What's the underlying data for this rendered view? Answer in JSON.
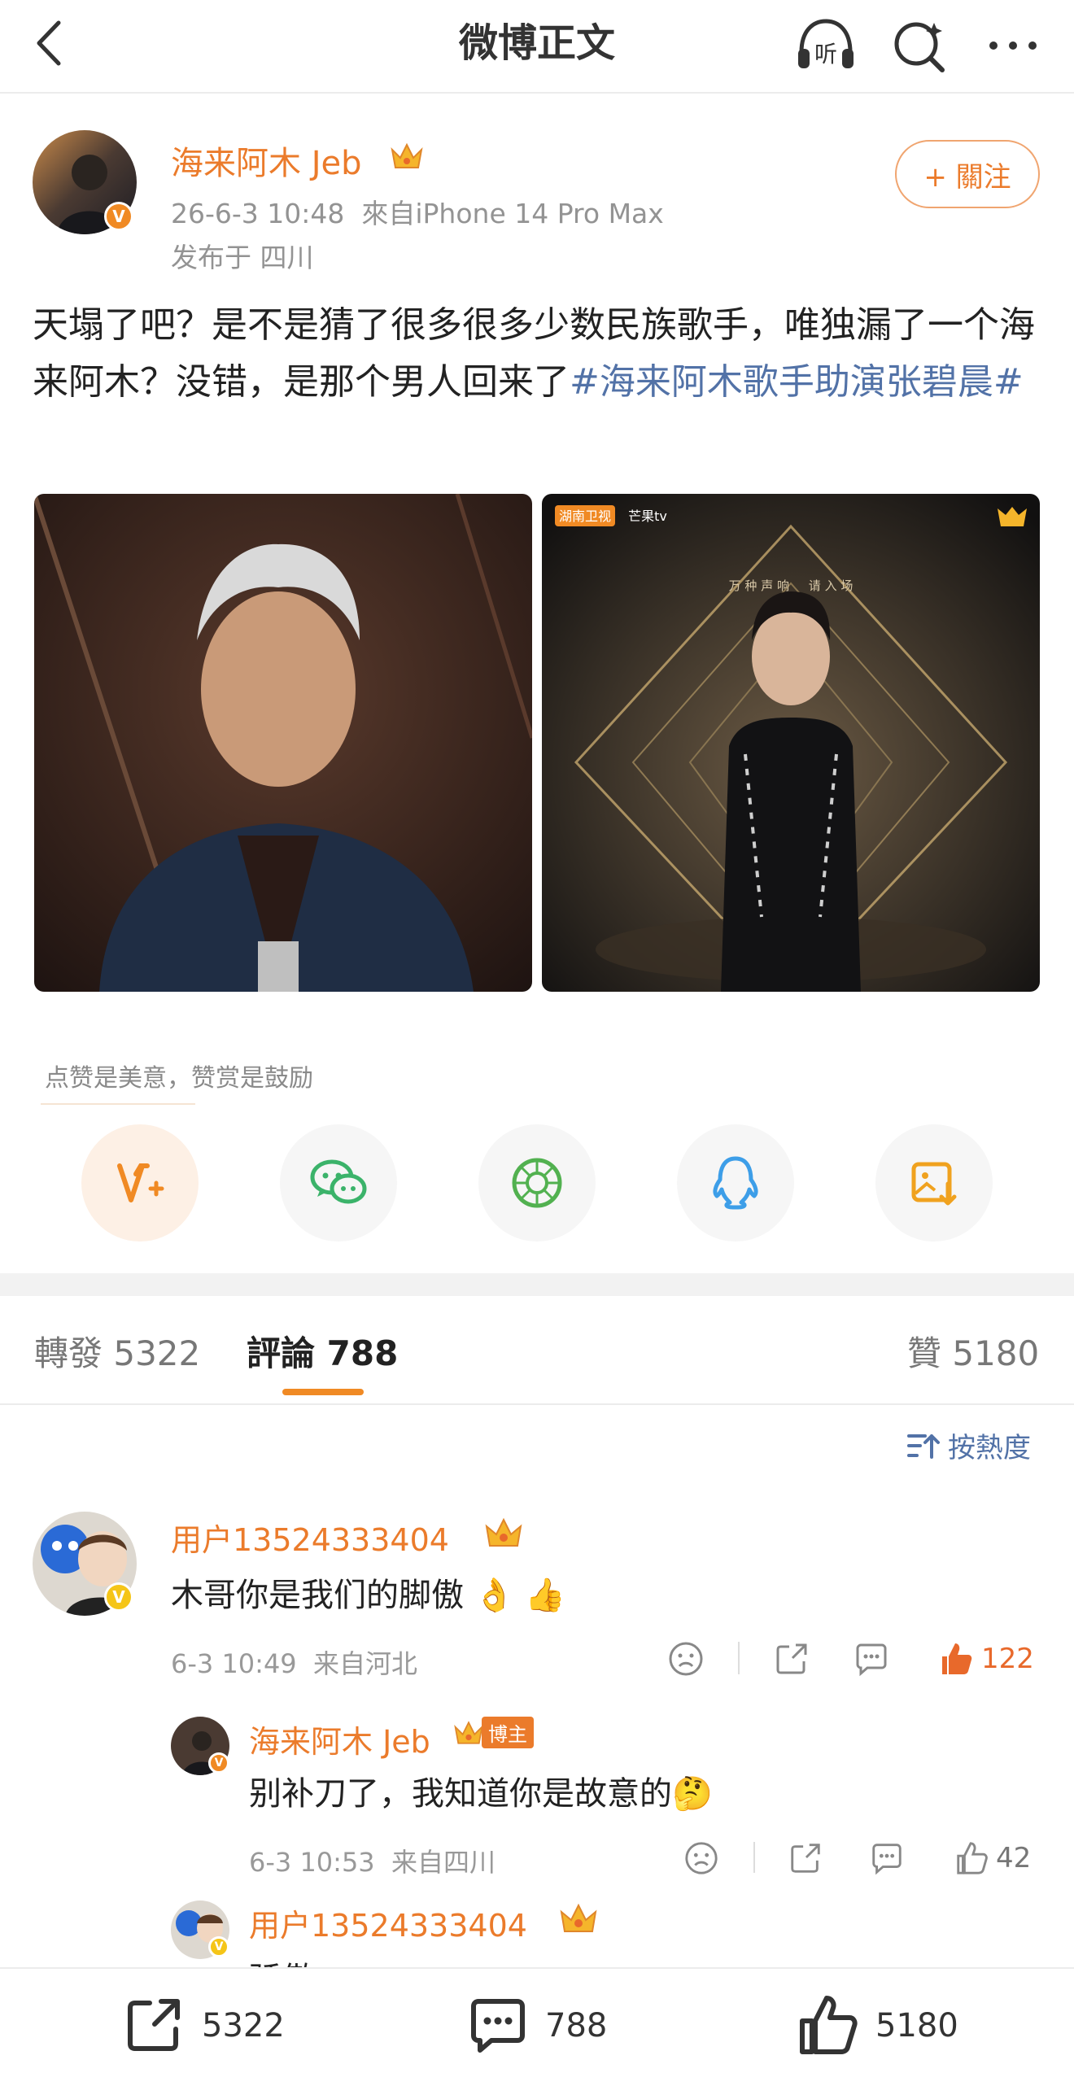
{
  "header": {
    "title": "微博正文",
    "listen_label": "听"
  },
  "post": {
    "author": "海来阿木 Jeb",
    "verified_badge": "V",
    "time_source": "26-6-3 10:48  來自iPhone 14 Pro Max",
    "location": "发布于 四川",
    "follow_label": "+ 關注",
    "text_plain": "天塌了吧？是不是猜了很多很多少数民族歌手，唯独漏了一个海来阿木？没错，是那个男人回来了",
    "topic": "#海来阿木歌手助演张碧晨#",
    "image2_logo1": "湖南卫视",
    "image2_logo2": "芒果tv",
    "image2_tagline": "万 种 声 响     请 入 场"
  },
  "reward": {
    "hint": "点赞是美意，赞赏是鼓励"
  },
  "share_icons": [
    "reward-icon",
    "wechat-icon",
    "moments-icon",
    "qq-icon",
    "save-image-icon"
  ],
  "tabs": {
    "repost": "轉發 5322",
    "comments": "評論 788",
    "likes": "贊 5180"
  },
  "sort_label": "按熱度",
  "comments": [
    {
      "user": "用户13524333404",
      "text": "木哥你是我们的脚傲",
      "emoji": "👌 👍",
      "meta": "6-3 10:49  来自河北",
      "likes": "122"
    },
    {
      "user": "海来阿木 Jeb",
      "tag": "博主",
      "text": "别补刀了，我知道你是故意的",
      "emoji": "🤔",
      "meta": "6-3 10:53  来自四川",
      "likes": "42"
    },
    {
      "user": "用户13524333404",
      "text": "骄傲"
    }
  ],
  "bottom_bar": {
    "repost": "5322",
    "comment": "788",
    "like": "5180"
  },
  "colors": {
    "accent": "#eb7b2b",
    "link": "#5272a7",
    "like_active": "#e8692b",
    "tab_indicator": "#f08a24"
  }
}
